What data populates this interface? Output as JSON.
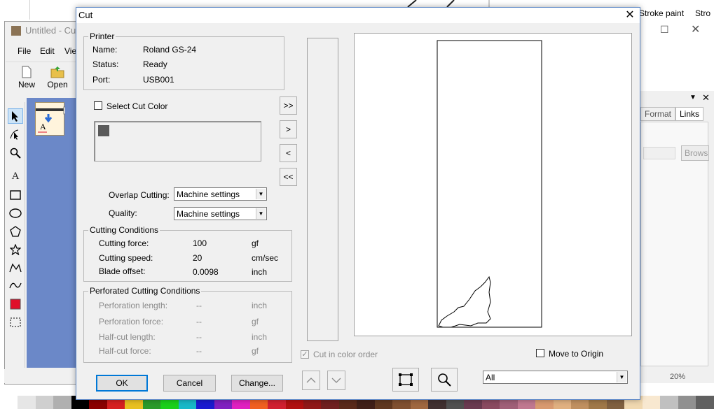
{
  "background_app": {
    "title": "Untitled - Cut",
    "menu": [
      "File",
      "Edit",
      "Vie"
    ],
    "toolbar": {
      "new_label": "New",
      "open_label": "Open"
    },
    "right_strip": {
      "stroke_paint": "Stroke paint",
      "stro": "Stro"
    },
    "right_tabs": [
      "Format",
      "Links"
    ],
    "browse_label": "Brows",
    "zoom": "20%",
    "tools": [
      "select-arrow-icon",
      "node-edit-icon",
      "zoom-icon",
      "text-icon",
      "rectangle-icon",
      "ellipse-icon",
      "polygon-icon",
      "star-icon",
      "polyline-icon",
      "curve-icon",
      "fill-color-icon",
      "marquee-icon"
    ]
  },
  "dialog": {
    "title": "Cut",
    "printer": {
      "group_label": "Printer",
      "name_label": "Name:",
      "name_value": "Roland GS-24",
      "status_label": "Status:",
      "status_value": "Ready",
      "port_label": "Port:",
      "port_value": "USB001"
    },
    "select_cut_color_label": "Select Cut Color",
    "select_cut_color_checked": false,
    "color_swatch": "#5a5a5a",
    "move_buttons": {
      "all_right": ">>",
      "right": ">",
      "left": "<",
      "all_left": "<<"
    },
    "overlap_cutting": {
      "label": "Overlap Cutting:",
      "value": "Machine settings"
    },
    "quality": {
      "label": "Quality:",
      "value": "Machine settings"
    },
    "cutting_conditions": {
      "group_label": "Cutting Conditions",
      "rows": [
        {
          "label": "Cutting force:",
          "value": "100",
          "unit": "gf"
        },
        {
          "label": "Cutting speed:",
          "value": "20",
          "unit": "cm/sec"
        },
        {
          "label": "Blade offset:",
          "value": "0.0098",
          "unit": "inch"
        }
      ]
    },
    "perforated": {
      "group_label": "Perforated Cutting Conditions",
      "rows": [
        {
          "label": "Perforation length:",
          "value": "--",
          "unit": "inch"
        },
        {
          "label": "Perforation  force:",
          "value": "--",
          "unit": "gf"
        },
        {
          "label": "Half-cut length:",
          "value": "--",
          "unit": "inch"
        },
        {
          "label": "Half-cut force:",
          "value": "--",
          "unit": "gf"
        }
      ]
    },
    "cut_in_color_order": {
      "label": "Cut in color order",
      "checked": true
    },
    "move_to_origin": {
      "label": "Move to Origin",
      "checked": false
    },
    "buttons": {
      "ok": "OK",
      "cancel": "Cancel",
      "change": "Change..."
    },
    "page_filter": {
      "value": "All"
    }
  },
  "colors": {
    "accent": "#0078d7",
    "dialog_bg": "#f0f0f0",
    "canvas_bg": "#6b88c8"
  }
}
